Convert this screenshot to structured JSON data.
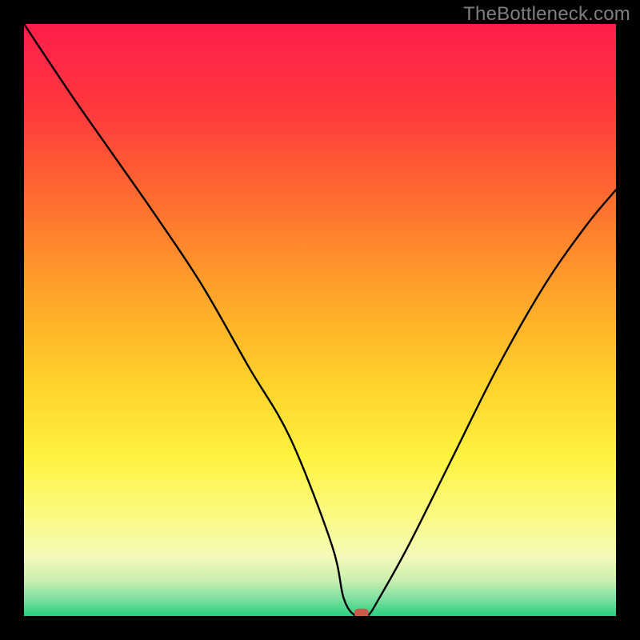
{
  "watermark": "TheBottleneck.com",
  "chart_data": {
    "type": "line",
    "title": "",
    "xlabel": "",
    "ylabel": "",
    "xlim": [
      0,
      100
    ],
    "ylim": [
      0,
      100
    ],
    "grid": false,
    "series": [
      {
        "name": "bottleneck-curve",
        "x": [
          0,
          8,
          15,
          22,
          30,
          38,
          45,
          52,
          54,
          56,
          58,
          60,
          65,
          72,
          80,
          88,
          95,
          100
        ],
        "y": [
          100,
          88,
          78,
          68,
          56,
          42,
          30,
          12,
          3,
          0,
          0,
          3,
          12,
          26,
          42,
          56,
          66,
          72
        ]
      }
    ],
    "marker": {
      "name": "optimal-point",
      "x": 57,
      "y": 0.5,
      "color": "#cc5a4a"
    },
    "background": {
      "type": "vertical-gradient",
      "stops": [
        {
          "pos": 0.0,
          "color": "#ff1d4b"
        },
        {
          "pos": 0.15,
          "color": "#ff3a3d"
        },
        {
          "pos": 0.3,
          "color": "#ff6e2f"
        },
        {
          "pos": 0.45,
          "color": "#ffa22a"
        },
        {
          "pos": 0.6,
          "color": "#ffd02a"
        },
        {
          "pos": 0.73,
          "color": "#fff23e"
        },
        {
          "pos": 0.83,
          "color": "#fbfb82"
        },
        {
          "pos": 0.9,
          "color": "#f5f9ba"
        },
        {
          "pos": 0.94,
          "color": "#c9efb0"
        },
        {
          "pos": 0.97,
          "color": "#7fe0a0"
        },
        {
          "pos": 1.0,
          "color": "#28d07e"
        }
      ]
    }
  }
}
